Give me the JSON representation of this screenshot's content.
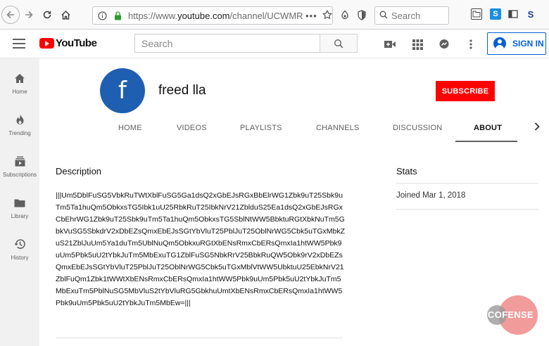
{
  "browser": {
    "url_prefix": "https://www.",
    "url_domain": "youtube.com",
    "url_path": "/channel/UCWMR/",
    "search_placeholder": "Search",
    "url_more": "•••"
  },
  "header": {
    "logo_text": "YouTube",
    "search_placeholder": "Search",
    "sign_in_label": "SIGN IN"
  },
  "sidebar": {
    "items": [
      {
        "label": "Home",
        "icon": "home-icon"
      },
      {
        "label": "Trending",
        "icon": "flame-icon"
      },
      {
        "label": "Subscriptions",
        "icon": "subscriptions-icon"
      },
      {
        "label": "Library",
        "icon": "folder-icon"
      },
      {
        "label": "History",
        "icon": "history-icon"
      }
    ]
  },
  "channel": {
    "avatar_letter": "f",
    "name": "freed lla",
    "subscribe_label": "SUBSCRIBE",
    "tabs": [
      "HOME",
      "VIDEOS",
      "PLAYLISTS",
      "CHANNELS",
      "DISCUSSION",
      "ABOUT"
    ],
    "active_tab": "ABOUT"
  },
  "about": {
    "description_title": "Description",
    "description_text": "|||Um5DblFuSG5VbkRuTWtXblFuSG5Ga1dsQ2xGbEJsRGxBbElrWG1Zbk9uT25Sbk9uTm5Ta1huQm5ObkxsTG5Ibk1uU25RbkRuT25IbkNrV21ZblduS25Ea1dsQ2xGbEJsRGxCbEhrWG1Zbk9uT25Sbk9uTm5Ta1huQm5ObkxsTG5SblNtWW5BbktuRGtXbkNuTm5GbkVuSG5SbkdrV2xDbEZsQmxEbEJsSGtYbVluT25PblJuT25OblNrWG5Cbk5uTGxMbkZuS21ZblJuUm5Ya1duTm5UblNuQm5ObkxuRGtXbENsRmxCbERsQmxIa1htWW5Pbk9uUm5Pbk5uU2tYbkJuTm5MbExuTG1ZblFuSG5NbkRrV25BbkRuQW5Obk9rV2xDbEZsQmxEbEJsSGtYbVluT25PblJuT25OblNrWG5Cbk5uTGxMblVtWW5UbktuU25EbkNrV21ZblFuQm1Zbk1tWWtXbENsRmxCbERsQmxIa1htWW5Pbk9uUm5Pbk5uU2tYbkJuTm5MbExuTm5PblNuSG5MbVluS2tYbVluRG5GbkhuUmtXbENsRmxCbERsQmxIa1htWW5Pbk9uUm5Pbk5uU2tYbkJuTm5MbEw=|||",
    "stats_title": "Stats",
    "joined": "Joined Mar 1, 2018"
  },
  "watermark": {
    "text": "COFENSE"
  }
}
